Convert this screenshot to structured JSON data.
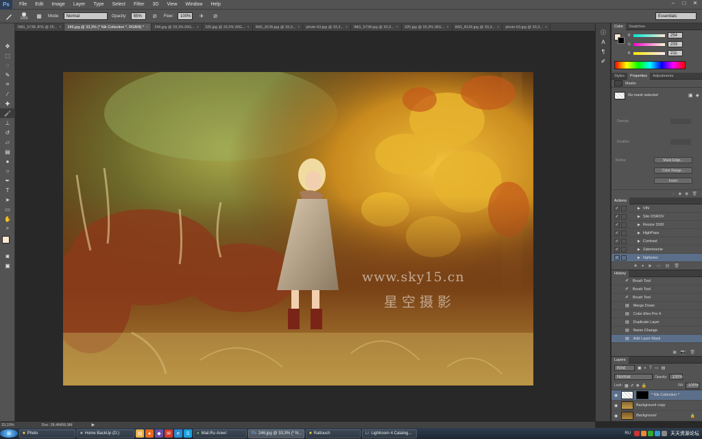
{
  "app": {
    "logo": "Ps"
  },
  "menu": [
    "File",
    "Edit",
    "Image",
    "Layer",
    "Type",
    "Select",
    "Filter",
    "3D",
    "View",
    "Window",
    "Help"
  ],
  "window_controls": [
    "–",
    "□",
    "✕"
  ],
  "options": {
    "brush_size": "1000",
    "mode_label": "Mode:",
    "mode_value": "Normal",
    "opacity_label": "Opacity:",
    "opacity_value": "55%",
    "flow_label": "Flow:",
    "flow_value": "100%",
    "workspace": "Essentials"
  },
  "tabs": [
    {
      "label": "IMG_5738.JPG @ 25...",
      "active": false
    },
    {
      "label": "246.jpg @ 33,3% (* Nik Collection *, RGB/8) *",
      "active": true
    },
    {
      "label": "246.jpg @ 33,3% (RG...",
      "active": false
    },
    {
      "label": "325.jpg @ 33,3% (RG...",
      "active": false
    },
    {
      "label": "IMG_8136.jpg @ 33,3...",
      "active": false
    },
    {
      "label": "photo-63.jpg @ 33,3...",
      "active": false
    },
    {
      "label": "IMG_5738.jpg @ 33,3...",
      "active": false
    },
    {
      "label": "325.jpg @ 33,3% (RG...",
      "active": false
    },
    {
      "label": "IMG_8136.jpg @ 33,3...",
      "active": false
    },
    {
      "label": "photo-63.jpg @ 33,3...",
      "active": false
    }
  ],
  "watermark": {
    "line1": "www.sky15.cn",
    "line2": "星空摄影"
  },
  "color_panel": {
    "tabs": [
      "Color",
      "Swatches"
    ],
    "r_label": "R",
    "r": "254",
    "g_label": "G",
    "g": "233",
    "b_label": "B",
    "b": "211",
    "fg": "#fee9d3",
    "bg": "#000000"
  },
  "properties": {
    "tabs": [
      "Styles",
      "Properties",
      "Adjustments"
    ],
    "title": "Masks",
    "no_mask": "No mask selected",
    "density": "Density:",
    "feather": "Feather:",
    "refine": "Refine:",
    "mask_edge": "Mask Edge...",
    "color_range": "Color Range...",
    "invert": "Invert"
  },
  "actions": {
    "title": "Actions",
    "items": [
      "VIN",
      "Site OSROV",
      "Resize 1500",
      "HighPass",
      "Contrast",
      "Zatemnenie",
      "highpass"
    ]
  },
  "history": {
    "title": "History",
    "items": [
      "Brush Tool",
      "Brush Tool",
      "Brush Tool",
      "Merge Down",
      "Color Efex Pro 4",
      "Duplicate Layer",
      "Name Change",
      "Add Layer Mask"
    ]
  },
  "layers": {
    "title": "Layers",
    "kind": "Kind",
    "blend": "Normal",
    "opacity_label": "Opacity:",
    "opacity": "100%",
    "lock_label": "Lock:",
    "fill_label": "Fill:",
    "fill": "100%",
    "items": [
      {
        "name": "* Nik Collection *"
      },
      {
        "name": "Background copy"
      },
      {
        "name": "Background"
      }
    ]
  },
  "status": {
    "zoom": "33,33%",
    "doc": "Doc: 28,4M/56,9M"
  },
  "taskbar": {
    "items": [
      "Photo",
      "Home BackUp (D:)",
      "Mail.Ru Агент",
      "246.jpg @ 33,3% (* N...",
      "Rattouch",
      "Lightroom 4 Catalog..."
    ],
    "lang": "RU",
    "tray_text": "天天资源论坛"
  }
}
